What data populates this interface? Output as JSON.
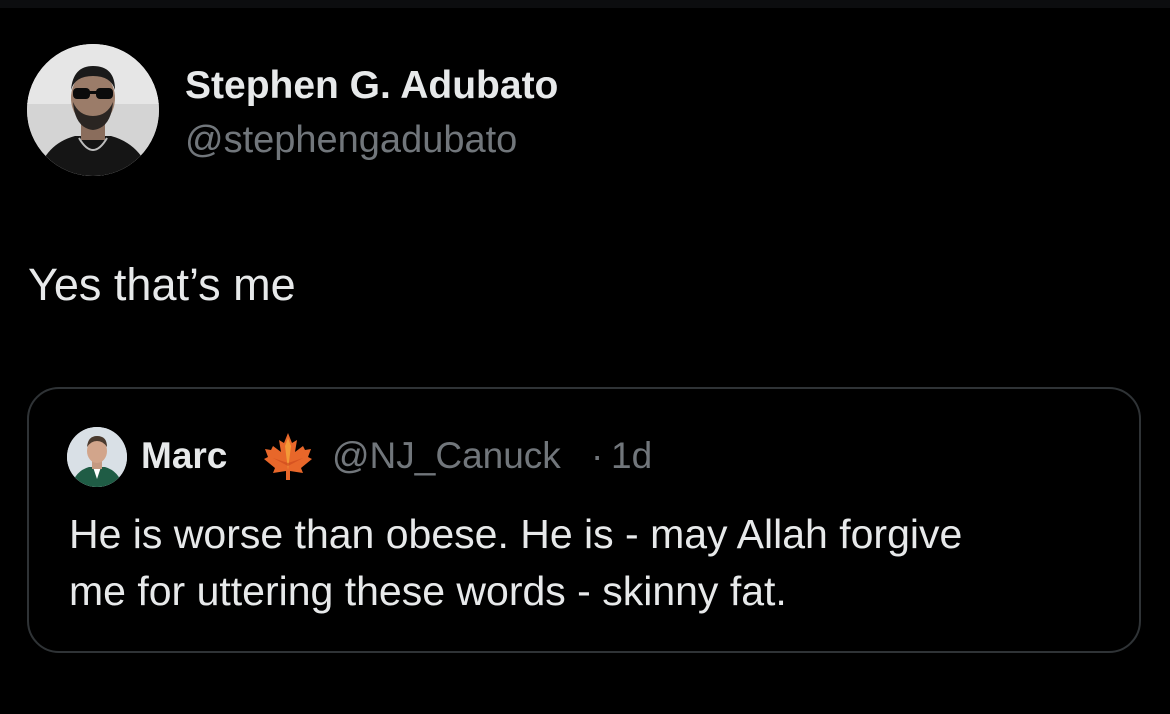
{
  "tweet": {
    "author": {
      "name": "Stephen G. Adubato",
      "handle": "@stephengadubato",
      "avatar_icon": "profile-photo-man-sunglasses"
    },
    "text": "Yes that’s me"
  },
  "quoted_tweet": {
    "author": {
      "name": "Marc",
      "badge_icon": "maple-leaf-icon",
      "handle": "@NJ_Canuck",
      "separator": "·",
      "time": "1d",
      "avatar_icon": "profile-photo-man-green-jacket"
    },
    "text_lines": [
      "He is worse than obese. He is - may Allah forgive",
      "me for uttering these words - skinny fat."
    ]
  },
  "colors": {
    "background": "#000000",
    "primary_text": "#e7e9ea",
    "secondary_text": "#71767b",
    "border": "#2f3336",
    "maple_leaf": "#e8672a"
  }
}
